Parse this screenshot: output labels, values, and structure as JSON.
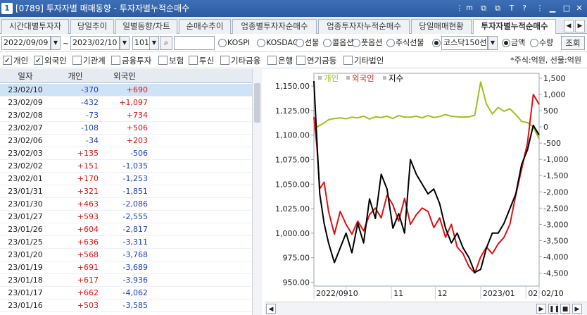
{
  "window": {
    "number": "1",
    "title": "[0789] 투자자별 매매동향 - 투자자별누적순매수",
    "icons": [
      "menu-icon",
      "m-icon",
      "link-icon",
      "copy-icon",
      "text-icon",
      "help-icon",
      "dots-icon",
      "minimize-icon",
      "maximize-icon",
      "close-icon"
    ],
    "icon_glyphs": [
      "⋮",
      "m",
      "⧉",
      "⧉",
      "T",
      "?",
      "⋮",
      "▁",
      "□",
      "✕"
    ]
  },
  "tabs": [
    {
      "label": "시간대별투자자",
      "active": false
    },
    {
      "label": "당일추이",
      "active": false
    },
    {
      "label": "일별동향/차트",
      "active": false
    },
    {
      "label": "순매수추이",
      "active": false
    },
    {
      "label": "업종별투자자순매수",
      "active": false
    },
    {
      "label": "업종투자자누적순매수",
      "active": false
    },
    {
      "label": "당일매매현황",
      "active": false
    },
    {
      "label": "투자자별누적순매수",
      "active": true
    }
  ],
  "filters": {
    "start_date": "2022/09/09",
    "separator": "~",
    "end_date": "2023/02/10",
    "count": "101",
    "code_value": "",
    "markets": [
      {
        "label": "KOSPI",
        "selected": false
      },
      {
        "label": "KOSDAQ",
        "selected": false
      },
      {
        "label": "선물",
        "selected": false
      },
      {
        "label": "콜옵션",
        "selected": false
      },
      {
        "label": "풋옵션",
        "selected": false
      },
      {
        "label": "주식선물",
        "selected": false
      },
      {
        "label": "코스닥150선",
        "selected": true
      }
    ],
    "units": [
      {
        "label": "금액",
        "selected": true
      },
      {
        "label": "수량",
        "selected": false
      }
    ],
    "search_button": "조회"
  },
  "investors": [
    {
      "label": "개인",
      "checked": true
    },
    {
      "label": "외국인",
      "checked": true
    },
    {
      "label": "기관계",
      "checked": false
    },
    {
      "label": "금융투자",
      "checked": false
    },
    {
      "label": "보험",
      "checked": false
    },
    {
      "label": "투신",
      "checked": false
    },
    {
      "label": "기타금융",
      "checked": false
    },
    {
      "label": "은행",
      "checked": false
    },
    {
      "label": "연기금등",
      "checked": false
    },
    {
      "label": "기타법인",
      "checked": false
    }
  ],
  "unit_note": "*주식:억원, 선물:억원",
  "table": {
    "headers": [
      "일자",
      "개인",
      "외국인"
    ],
    "rows": [
      {
        "date": "23/02/10",
        "individual": "-370",
        "foreign": "+690"
      },
      {
        "date": "23/02/09",
        "individual": "-432",
        "foreign": "+1,097"
      },
      {
        "date": "23/02/08",
        "individual": "-73",
        "foreign": "+734"
      },
      {
        "date": "23/02/07",
        "individual": "-108",
        "foreign": "+506"
      },
      {
        "date": "23/02/06",
        "individual": "-34",
        "foreign": "+203"
      },
      {
        "date": "23/02/03",
        "individual": "+135",
        "foreign": "-506"
      },
      {
        "date": "23/02/02",
        "individual": "+151",
        "foreign": "-1,035"
      },
      {
        "date": "23/02/01",
        "individual": "+170",
        "foreign": "-1,253"
      },
      {
        "date": "23/01/31",
        "individual": "+321",
        "foreign": "-1,851"
      },
      {
        "date": "23/01/30",
        "individual": "+463",
        "foreign": "-2,086"
      },
      {
        "date": "23/01/27",
        "individual": "+593",
        "foreign": "-2,555"
      },
      {
        "date": "23/01/26",
        "individual": "+604",
        "foreign": "-2,817"
      },
      {
        "date": "23/01/25",
        "individual": "+636",
        "foreign": "-3,311"
      },
      {
        "date": "23/01/20",
        "individual": "+568",
        "foreign": "-3,768"
      },
      {
        "date": "23/01/19",
        "individual": "+691",
        "foreign": "-3,689"
      },
      {
        "date": "23/01/18",
        "individual": "+617",
        "foreign": "-3,936"
      },
      {
        "date": "23/01/17",
        "individual": "+662",
        "foreign": "-4,062"
      },
      {
        "date": "23/01/16",
        "individual": "+503",
        "foreign": "-3,585"
      }
    ]
  },
  "chart_data": {
    "type": "line",
    "legend": [
      {
        "name": "개인",
        "color": "#9cc21a"
      },
      {
        "name": "외국인",
        "color": "#e01010"
      },
      {
        "name": "지수",
        "color": "#000000"
      }
    ],
    "left_axis": {
      "ticks": [
        "1,150.00",
        "1,125.00",
        "1,100.00",
        "1,075.00",
        "1,050.00",
        "1,025.00",
        "1,000.00",
        "975.00",
        "950.00"
      ],
      "range": [
        946,
        1163
      ]
    },
    "right_axis": {
      "ticks": [
        "1,500",
        "1,000",
        "500",
        "0",
        "-500",
        "-1,000",
        "-1,500",
        "-2,000",
        "-2,500",
        "-3,000",
        "-3,500",
        "-4,000",
        "-4,500"
      ],
      "range": [
        -4900,
        1650
      ]
    },
    "x_labels": [
      "2022/09",
      "10",
      "11",
      "12",
      "2023/01",
      "02",
      "02/10"
    ],
    "x_label_days": [
      0,
      22,
      53,
      83,
      114,
      145,
      154
    ],
    "x_span_days": 154,
    "x_start_date": "2022-09-09",
    "series": [
      {
        "name": "개인",
        "axis": "right",
        "color": "#9cc21a",
        "x_days": [
          0,
          2,
          4,
          7,
          10,
          14,
          18,
          22,
          26,
          30,
          34,
          38,
          42,
          46,
          50,
          54,
          58,
          62,
          66,
          70,
          74,
          78,
          82,
          86,
          90,
          94,
          98,
          102,
          106,
          110,
          114,
          118,
          122,
          126,
          130,
          134,
          138,
          142,
          146,
          150,
          154
        ],
        "values": [
          -100,
          0,
          50,
          120,
          220,
          260,
          280,
          250,
          300,
          280,
          330,
          240,
          310,
          290,
          330,
          260,
          350,
          300,
          300,
          330,
          280,
          350,
          290,
          320,
          380,
          330,
          310,
          300,
          310,
          360,
          1380,
          700,
          400,
          600,
          480,
          560,
          380,
          170,
          130,
          0,
          -370
        ]
      },
      {
        "name": "외국인",
        "axis": "right",
        "color": "#e01010",
        "x_days": [
          0,
          2,
          4,
          7,
          10,
          14,
          18,
          22,
          26,
          30,
          34,
          38,
          42,
          46,
          50,
          54,
          58,
          62,
          66,
          70,
          74,
          78,
          82,
          86,
          90,
          94,
          98,
          102,
          106,
          110,
          114,
          118,
          122,
          126,
          130,
          134,
          138,
          142,
          146,
          150,
          154
        ],
        "values": [
          300,
          -600,
          -1900,
          -1700,
          -2600,
          -3300,
          -2600,
          -3000,
          -3300,
          -2900,
          -3200,
          -2700,
          -2500,
          -2800,
          -2100,
          -2400,
          -2900,
          -2200,
          -3000,
          -2700,
          -2500,
          -2600,
          -3100,
          -2800,
          -3400,
          -3000,
          -3700,
          -3900,
          -4300,
          -4500,
          -4000,
          -3700,
          -3900,
          -3600,
          -3400,
          -3000,
          -2100,
          -1300,
          -500,
          1000,
          690
        ]
      },
      {
        "name": "지수",
        "axis": "left",
        "color": "#000000",
        "x_days": [
          0,
          2,
          4,
          7,
          10,
          14,
          18,
          22,
          26,
          30,
          34,
          38,
          42,
          46,
          50,
          54,
          58,
          62,
          66,
          70,
          74,
          78,
          82,
          86,
          90,
          94,
          98,
          102,
          106,
          110,
          114,
          118,
          122,
          126,
          130,
          134,
          138,
          142,
          146,
          150,
          154
        ],
        "values": [
          1155,
          1095,
          1040,
          1010,
          990,
          970,
          985,
          1000,
          980,
          1010,
          990,
          1035,
          1015,
          1060,
          1045,
          1005,
          1020,
          1000,
          1075,
          1060,
          1050,
          1040,
          1045,
          1030,
          1005,
          990,
          1000,
          985,
          975,
          960,
          963,
          985,
          1000,
          1000,
          1010,
          1025,
          1040,
          1070,
          1085,
          1110,
          1100
        ]
      }
    ]
  }
}
